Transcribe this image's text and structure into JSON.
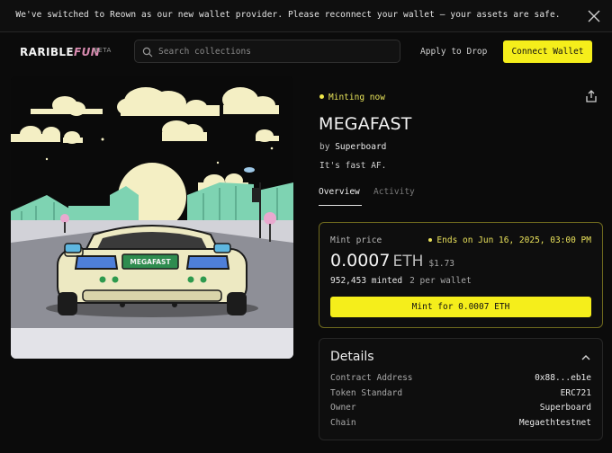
{
  "banner": {
    "message": "We've switched to Reown as our new wallet provider. Please reconnect your wallet – your assets are safe.",
    "close_icon": "close-icon"
  },
  "header": {
    "logo_main": "RARIBLE",
    "logo_accent": "FUN",
    "logo_badge": "BETA",
    "search_placeholder": "Search collections",
    "apply_label": "Apply to Drop",
    "connect_label": "Connect Wallet"
  },
  "collection": {
    "status": "Minting now",
    "title": "MEGAFAST",
    "by_prefix": "by",
    "creator": "Superboard",
    "description": "It's fast AF.",
    "tabs": [
      {
        "label": "Overview",
        "active": true
      },
      {
        "label": "Activity",
        "active": false
      }
    ],
    "artwork_plate": "MEGAFAST"
  },
  "mint": {
    "label": "Mint price",
    "ends": "Ends on Jun 16, 2025, 03:00 PM",
    "price": "0.0007",
    "currency": "ETH",
    "usd": "$1.73",
    "minted": "952,453 minted",
    "per_wallet": "2 per wallet",
    "button": "Mint for 0.0007 ETH"
  },
  "details": {
    "title": "Details",
    "rows": [
      {
        "key": "Contract Address",
        "value": "0x88...eb1e"
      },
      {
        "key": "Token Standard",
        "value": "ERC721"
      },
      {
        "key": "Owner",
        "value": "Superboard"
      },
      {
        "key": "Chain",
        "value": "Megaethtestnet"
      }
    ]
  },
  "colors": {
    "accent_yellow": "#f5ee1b",
    "status_yellow": "#e8e05a",
    "background": "#0b0b0b"
  }
}
